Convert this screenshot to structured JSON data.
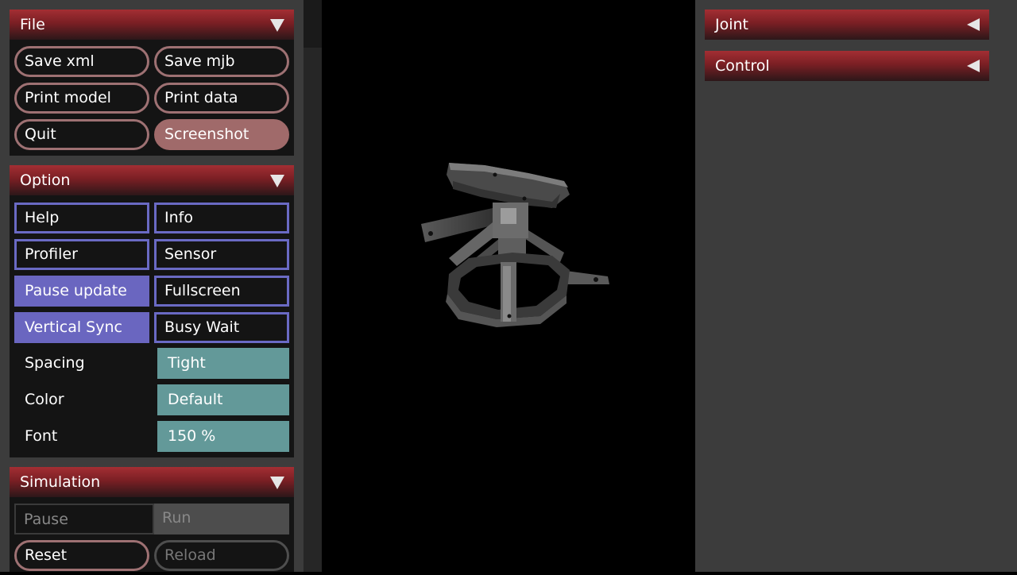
{
  "file": {
    "title": "File",
    "buttons": [
      "Save xml",
      "Save mjb",
      "Print model",
      "Print data",
      "Quit",
      "Screenshot"
    ]
  },
  "option": {
    "title": "Option",
    "toggles": [
      "Help",
      "Info",
      "Profiler",
      "Sensor",
      "Pause update",
      "Fullscreen",
      "Vertical Sync",
      "Busy Wait"
    ],
    "spacing_label": "Spacing",
    "spacing_value": "Tight",
    "color_label": "Color",
    "color_value": "Default",
    "font_label": "Font",
    "font_value": "150 %"
  },
  "simulation": {
    "title": "Simulation",
    "pause": "Pause",
    "run": "Run",
    "reset": "Reset",
    "reload": "Reload"
  },
  "right": {
    "joint": "Joint",
    "control": "Control"
  },
  "colors": {
    "header": "#a32e33",
    "toggle_on": "#6a66c0",
    "select": "#639999",
    "button_border": "#9e7173"
  }
}
